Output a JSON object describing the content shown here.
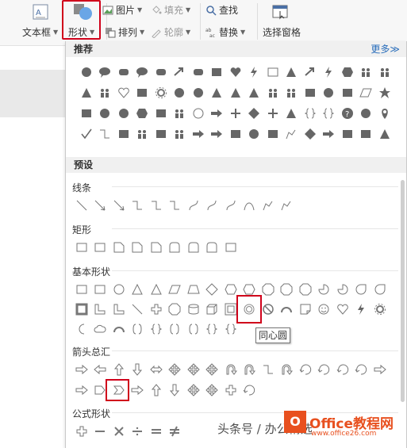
{
  "ribbon": {
    "textbox_label": "文本框",
    "shape_label": "形状",
    "picture_label": "图片",
    "fill_label": "填充",
    "arrange_label": "排列",
    "outline_label": "轮廓",
    "find_label": "查找",
    "replace_label": "替换",
    "select_pane_label": "选择窗格"
  },
  "panel": {
    "recommended_label": "推荐",
    "more_label": "更多≫",
    "preset_label": "预设",
    "sections": {
      "lines": "线条",
      "rect": "矩形",
      "basic": "基本形状",
      "arrows": "箭头总汇",
      "formula": "公式形状"
    }
  },
  "tooltip": "同心圆",
  "watermark": "头条号 / 办公精选",
  "logo": {
    "main": "Office教程网",
    "sub": "www.office26.com"
  },
  "colors": {
    "highlight": "#d0021b",
    "icon": "#666666",
    "link": "#2a6ebb"
  }
}
